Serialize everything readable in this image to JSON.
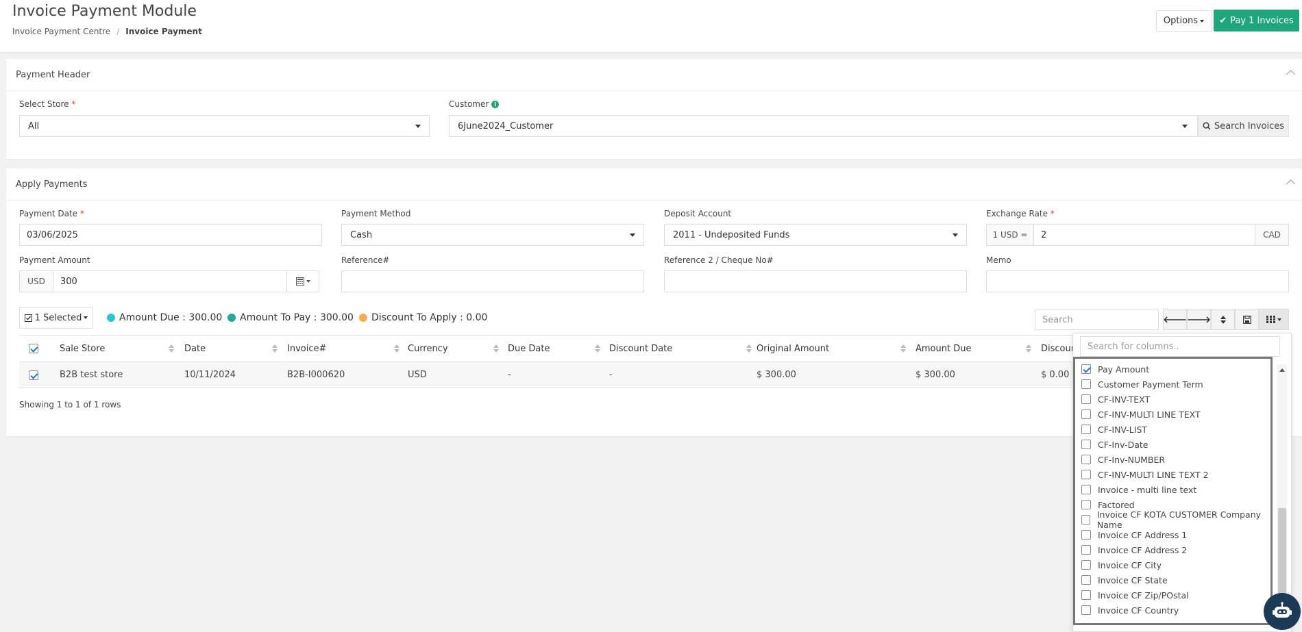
{
  "header": {
    "title": "Invoice Payment Module",
    "breadcrumb": [
      "Invoice Payment Centre",
      "/",
      "Invoice Payment"
    ],
    "options_label": "Options",
    "pay_label": "Pay 1 Invoices"
  },
  "payment_header": {
    "title": "Payment Header",
    "store_label": "Select Store",
    "store_required": "*",
    "store_value": "All",
    "customer_label": "Customer",
    "customer_value": "6June2024_Customer",
    "search_invoices_label": "Search Invoices"
  },
  "apply_payments": {
    "title": "Apply Payments",
    "payment_date_label": "Payment Date",
    "payment_date_value": "03/06/2025",
    "payment_method_label": "Payment Method",
    "payment_method_value": "Cash",
    "deposit_account_label": "Deposit Account",
    "deposit_account_value": "2011 - Undeposited Funds",
    "exchange_rate_label": "Exchange Rate",
    "exchange_prefix": "1 USD =",
    "exchange_value": "2",
    "exchange_suffix": "CAD",
    "payment_amount_label": "Payment Amount",
    "payment_currency": "USD",
    "payment_amount_value": "300",
    "reference_label": "Reference#",
    "reference2_label": "Reference 2 / Cheque No#",
    "memo_label": "Memo",
    "required": "*"
  },
  "summary": {
    "selected_label": "1 Selected",
    "amount_due": "Amount Due : 300.00",
    "amount_to_pay": "Amount To Pay : 300.00",
    "discount_to_apply": "Discount To Apply : 0.00",
    "search_placeholder": "Search",
    "colors": {
      "due": "#26c6da",
      "pay": "#26a69a",
      "discount": "#ffa94d"
    }
  },
  "table": {
    "columns": [
      "Sale Store",
      "Date",
      "Invoice#",
      "Currency",
      "Due Date",
      "Discount Date",
      "Original Amount",
      "Amount Due",
      "Discoun"
    ],
    "rows": [
      [
        "B2B test store",
        "10/11/2024",
        "B2B-I000620",
        "USD",
        "-",
        "-",
        "$ 300.00",
        "$ 300.00",
        "$ 0.00"
      ]
    ],
    "footer": "Showing 1 to 1 of 1 rows"
  },
  "column_menu": {
    "search_placeholder": "Search for columns..",
    "items": [
      {
        "label": "Pay Amount",
        "checked": true
      },
      {
        "label": "Customer Payment Term",
        "checked": false
      },
      {
        "label": "CF-INV-TEXT",
        "checked": false
      },
      {
        "label": "CF-INV-MULTI LINE TEXT",
        "checked": false
      },
      {
        "label": "CF-INV-LIST",
        "checked": false
      },
      {
        "label": "CF-Inv-Date",
        "checked": false
      },
      {
        "label": "CF-Inv-NUMBER",
        "checked": false
      },
      {
        "label": "CF-INV-MULTI LINE TEXT 2",
        "checked": false
      },
      {
        "label": "Invoice - multi line text",
        "checked": false
      },
      {
        "label": "Factored",
        "checked": false
      },
      {
        "label": "Invoice CF KOTA CUSTOMER Company Name",
        "checked": false
      },
      {
        "label": "Invoice CF Address 1",
        "checked": false
      },
      {
        "label": "Invoice CF Address 2",
        "checked": false
      },
      {
        "label": "Invoice CF City",
        "checked": false
      },
      {
        "label": "Invoice CF State",
        "checked": false
      },
      {
        "label": "Invoice CF Zip/POstal",
        "checked": false
      },
      {
        "label": "Invoice CF Country",
        "checked": false
      }
    ]
  },
  "theme": {
    "accent": "#1fa67a",
    "info": "#1fa67a"
  }
}
